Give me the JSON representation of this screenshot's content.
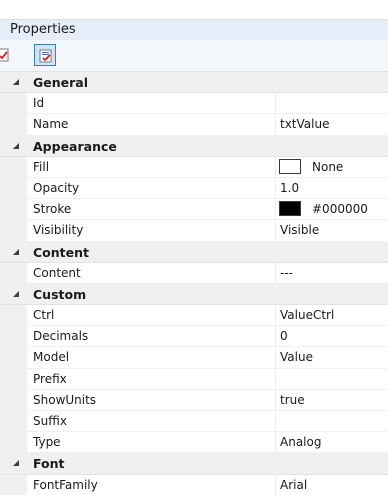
{
  "panel": {
    "title": "Properties"
  },
  "toolbar": {
    "buttons": [
      {
        "icon": "categorized-view-icon",
        "selected": false
      },
      {
        "icon": "alphabetical-view-icon",
        "selected": true
      }
    ]
  },
  "colors": {
    "fill_swatch": "#ffffff",
    "stroke_swatch": "#000000"
  },
  "categories": {
    "general": {
      "label": "General",
      "props": {
        "id": {
          "name": "Id",
          "value": ""
        },
        "name": {
          "name": "Name",
          "value": "txtValue"
        }
      }
    },
    "appearance": {
      "label": "Appearance",
      "props": {
        "fill": {
          "name": "Fill",
          "value": "None"
        },
        "opacity": {
          "name": "Opacity",
          "value": "1.0"
        },
        "stroke": {
          "name": "Stroke",
          "value": "#000000"
        },
        "visibility": {
          "name": "Visibility",
          "value": "Visible"
        }
      }
    },
    "content": {
      "label": "Content",
      "props": {
        "content": {
          "name": "Content",
          "value": "---"
        }
      }
    },
    "custom": {
      "label": "Custom",
      "props": {
        "ctrl": {
          "name": "Ctrl",
          "value": "ValueCtrl"
        },
        "decimals": {
          "name": "Decimals",
          "value": "0"
        },
        "model": {
          "name": "Model",
          "value": "Value"
        },
        "prefix": {
          "name": "Prefix",
          "value": ""
        },
        "showunits": {
          "name": "ShowUnits",
          "value": "true"
        },
        "suffix": {
          "name": "Suffix",
          "value": ""
        },
        "type": {
          "name": "Type",
          "value": "Analog"
        }
      }
    },
    "font": {
      "label": "Font",
      "props": {
        "fontfamily": {
          "name": "FontFamily",
          "value": "Arial"
        }
      }
    }
  }
}
